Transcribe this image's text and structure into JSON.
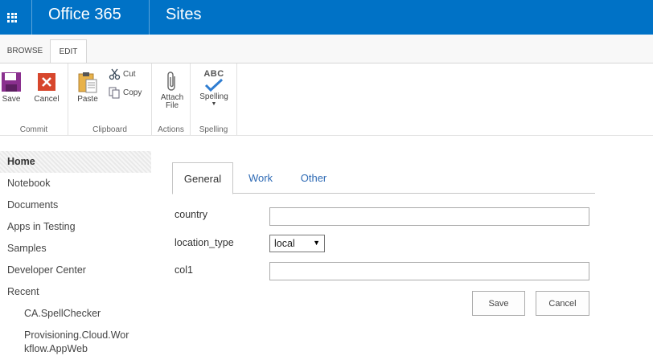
{
  "suitebar": {
    "brand": "Office 365",
    "app": "Sites",
    "color": "#0072c6"
  },
  "ribbon_tabs": [
    {
      "label": "BROWSE"
    },
    {
      "label": "EDIT",
      "active": true
    }
  ],
  "ribbon": {
    "commit": {
      "group_label": "Commit",
      "save": "Save",
      "cancel": "Cancel"
    },
    "clipboard": {
      "group_label": "Clipboard",
      "paste": "Paste",
      "cut": "Cut",
      "copy": "Copy"
    },
    "actions": {
      "group_label": "Actions",
      "attach_line1": "Attach",
      "attach_line2": "File"
    },
    "spelling": {
      "group_label": "Spelling",
      "spelling": "Spelling",
      "abc": "ABC"
    }
  },
  "nav": {
    "items": [
      {
        "label": "Home",
        "selected": true
      },
      {
        "label": "Notebook"
      },
      {
        "label": "Documents"
      },
      {
        "label": "Apps in Testing"
      },
      {
        "label": "Samples"
      },
      {
        "label": "Developer Center"
      },
      {
        "label": "Recent"
      }
    ],
    "recent": [
      "CA.SpellChecker",
      "Provisioning.Cloud.Wor",
      "kflow.AppWeb"
    ]
  },
  "form": {
    "tabs": [
      {
        "label": "General",
        "active": true
      },
      {
        "label": "Work"
      },
      {
        "label": "Other"
      }
    ],
    "fields": {
      "country": {
        "label": "country",
        "value": ""
      },
      "location_type": {
        "label": "location_type",
        "value": "local"
      },
      "col1": {
        "label": "col1",
        "value": ""
      }
    },
    "save": "Save",
    "cancel": "Cancel"
  }
}
